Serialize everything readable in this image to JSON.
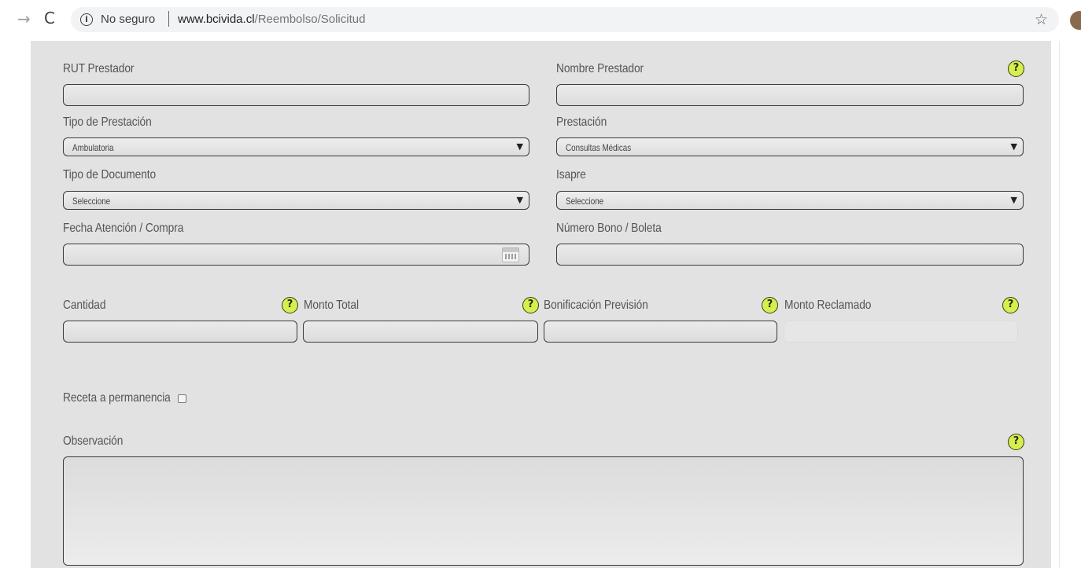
{
  "browser": {
    "security_text": "No seguro",
    "url_host": "www.bcivida.cl",
    "url_path": "/Reembolso/Solicitud"
  },
  "form": {
    "rut_prestador": {
      "label": "RUT Prestador",
      "value": ""
    },
    "nombre_prestador": {
      "label": "Nombre Prestador",
      "value": ""
    },
    "tipo_prestacion": {
      "label": "Tipo de Prestación",
      "selected": "Ambulatoria"
    },
    "prestacion": {
      "label": "Prestación",
      "selected": "Consultas Médicas"
    },
    "tipo_documento": {
      "label": "Tipo de Documento",
      "selected": "Seleccione"
    },
    "isapre": {
      "label": "Isapre",
      "selected": "Seleccione"
    },
    "fecha_atencion": {
      "label": "Fecha Atención / Compra",
      "value": ""
    },
    "numero_bono": {
      "label": "Número Bono / Boleta",
      "value": ""
    },
    "cantidad": {
      "label": "Cantidad",
      "value": ""
    },
    "monto_total": {
      "label": "Monto Total",
      "value": ""
    },
    "bonificacion_prevision": {
      "label": "Bonificación Previsión",
      "value": ""
    },
    "monto_reclamado": {
      "label": "Monto Reclamado",
      "value": ""
    },
    "receta_permanencia": {
      "label": "Receta a permanencia",
      "checked": false
    },
    "observacion": {
      "label": "Observación",
      "value": ""
    }
  },
  "icons": {
    "nav_forward": "→",
    "reload": "C",
    "info": "i",
    "star": "☆",
    "help": "?",
    "select_arrow": "▼"
  },
  "colors": {
    "page_bg": "#e2e2e2",
    "help_badge": "#d6ef4e",
    "field_border": "#3a3a3a",
    "label_text": "#555555"
  }
}
